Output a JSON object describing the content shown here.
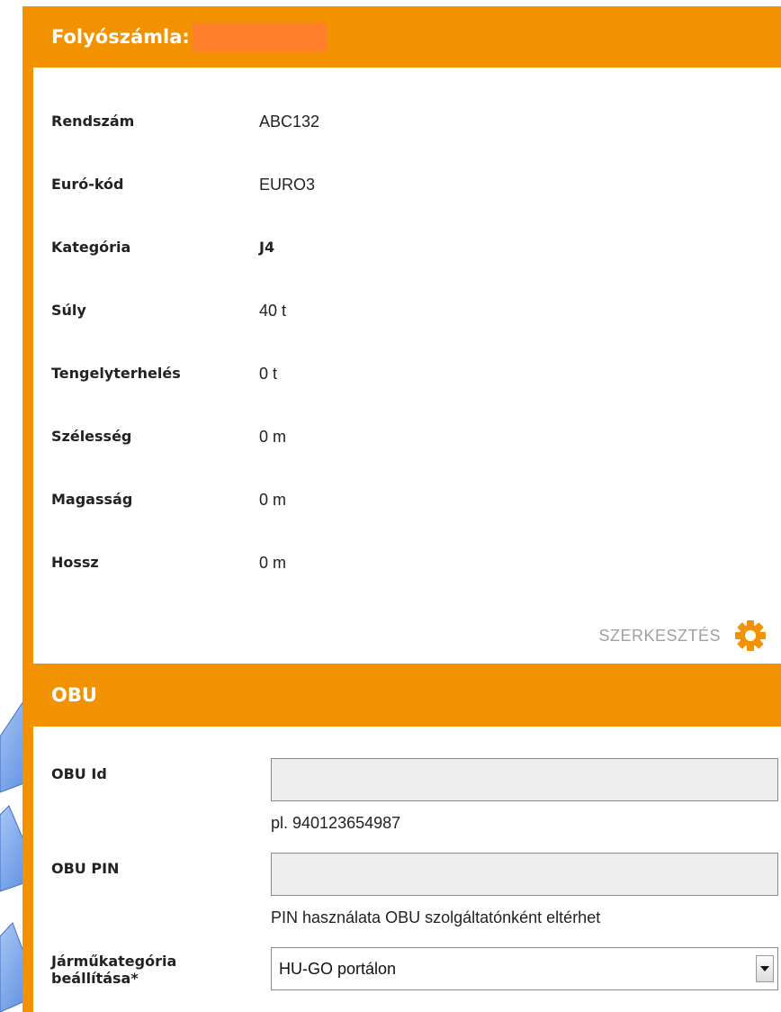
{
  "account": {
    "title": "Folyószámla:",
    "fields": [
      {
        "label": "Rendszám",
        "value": "ABC132"
      },
      {
        "label": "Euró-kód",
        "value": "EURO3"
      },
      {
        "label": "Kategória",
        "value": "J4"
      },
      {
        "label": "Súly",
        "value": "40 t"
      },
      {
        "label": "Tengelyterhelés",
        "value": "0 t"
      },
      {
        "label": "Szélesség",
        "value": "0 m"
      },
      {
        "label": "Magasság",
        "value": "0 m"
      },
      {
        "label": "Hossz",
        "value": "0 m"
      }
    ],
    "edit_label": "SZERKESZTÉS",
    "edit_icon": "gear-icon"
  },
  "obu": {
    "title": "OBU",
    "id_label": "OBU Id",
    "id_value": "",
    "id_hint": "pl. 940123654987",
    "pin_label": "OBU PIN",
    "pin_value": "",
    "pin_hint": "PIN használata OBU szolgáltatónként eltérhet",
    "category_label_line1": "Járműkategória",
    "category_label_line2": "beállítása*",
    "category_selected": "HU-GO portálon"
  },
  "colors": {
    "accent": "#f39200",
    "redaction": "#ff7f2a",
    "callout": "#6f9ee8"
  }
}
